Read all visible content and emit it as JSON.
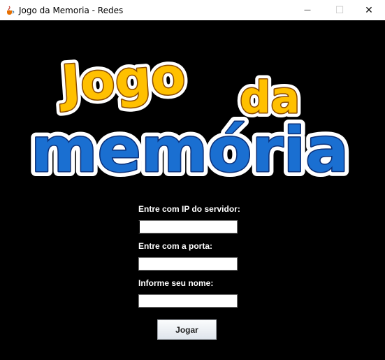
{
  "window": {
    "title": "Jogo da Memoria - Redes",
    "minimize_glyph": "—",
    "maximize_glyph": "☐",
    "close_glyph": "✕"
  },
  "logo": {
    "line1_word1": "Jogo",
    "line1_word2": "da",
    "line2": "memória"
  },
  "form": {
    "ip_label": "Entre com IP do servidor:",
    "ip_value": "",
    "port_label": "Entre com a porta:",
    "port_value": "",
    "name_label": "Informe seu nome:",
    "name_value": "",
    "play_button": "Jogar"
  },
  "colors": {
    "background": "#000000",
    "logo_yellow": "#ffc000",
    "logo_orange_outline": "#8a4a00",
    "logo_blue": "#1a6fd1",
    "logo_dark_blue": "#0a2f78"
  }
}
